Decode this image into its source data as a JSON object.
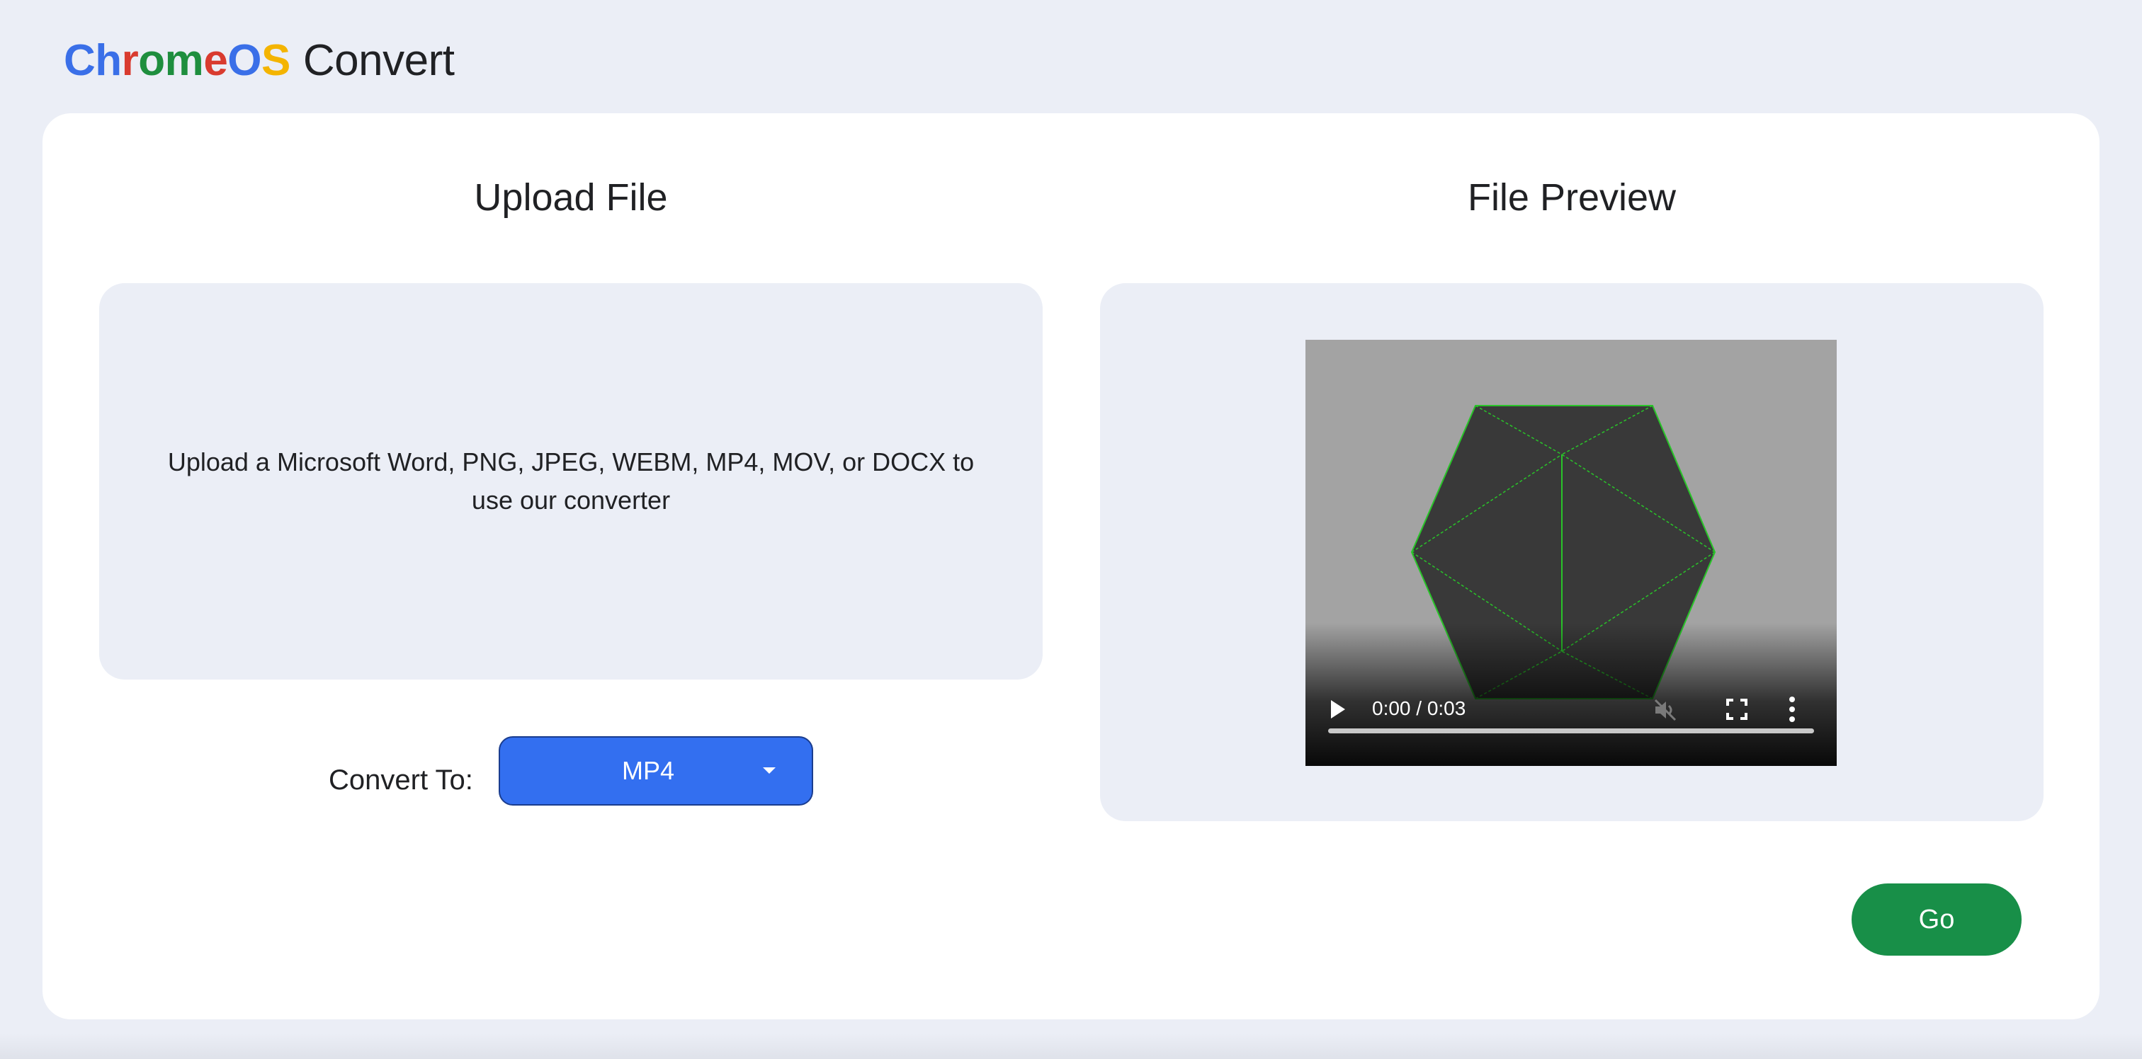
{
  "header": {
    "logo_letters": [
      {
        "char": "C",
        "color": "#3a6fe8"
      },
      {
        "char": "h",
        "color": "#3a6fe8"
      },
      {
        "char": "r",
        "color": "#d93b2f"
      },
      {
        "char": "o",
        "color": "#1e8e3e"
      },
      {
        "char": "m",
        "color": "#1e8e3e"
      },
      {
        "char": "e",
        "color": "#d93b2f"
      },
      {
        "char": "O",
        "color": "#3a6fe8"
      },
      {
        "char": "S",
        "color": "#f4b400"
      }
    ],
    "app_name": "Convert"
  },
  "upload": {
    "title": "Upload File",
    "hint": "Upload a Microsoft Word, PNG, JPEG, WEBM, MP4, MOV, or DOCX to use our converter"
  },
  "convert": {
    "label": "Convert To:",
    "selected_format": "MP4"
  },
  "preview": {
    "title": "File Preview",
    "video": {
      "time_display": "0:00 / 0:03",
      "progress": 0
    }
  },
  "actions": {
    "go_label": "Go"
  },
  "colors": {
    "page_bg": "#ebeef6",
    "select_bg": "#336ff0",
    "go_bg": "#188f48",
    "wireframe": "#29c429"
  }
}
